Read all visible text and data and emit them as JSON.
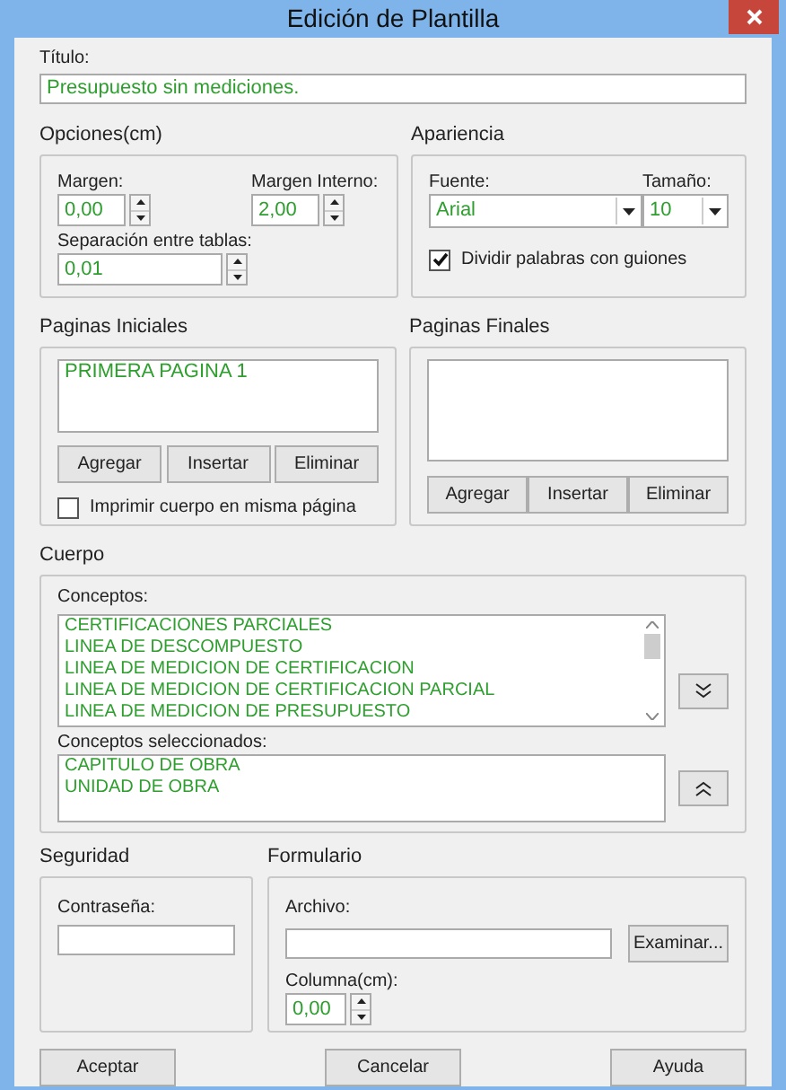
{
  "window": {
    "title": "Edición de Plantilla"
  },
  "titulo": {
    "label": "Título:",
    "value": "Presupuesto sin mediciones."
  },
  "opciones": {
    "header": "Opciones(cm)",
    "margen": {
      "label": "Margen:",
      "value": "0,00"
    },
    "margen_interno": {
      "label": "Margen Interno:",
      "value": "2,00"
    },
    "separacion": {
      "label": "Separación entre tablas:",
      "value": "0,01"
    }
  },
  "apariencia": {
    "header": "Apariencia",
    "fuente": {
      "label": "Fuente:",
      "value": "Arial"
    },
    "tamano": {
      "label": "Tamaño:",
      "value": "10"
    },
    "dividir": {
      "label": "Dividir palabras con guiones",
      "checked": true
    }
  },
  "paginas_iniciales": {
    "header": "Paginas Iniciales",
    "items": [
      "PRIMERA PAGINA 1"
    ],
    "buttons": [
      "Agregar",
      "Insertar",
      "Eliminar"
    ],
    "imprimir": {
      "label": "Imprimir cuerpo en misma página",
      "checked": false
    }
  },
  "paginas_finales": {
    "header": "Paginas Finales",
    "buttons": [
      "Agregar",
      "Insertar",
      "Eliminar"
    ]
  },
  "cuerpo": {
    "header": "Cuerpo",
    "conceptos_label": "Conceptos:",
    "conceptos": [
      "CERTIFICACIONES PARCIALES",
      "LINEA DE DESCOMPUESTO",
      "LINEA DE MEDICION DE CERTIFICACION",
      "LINEA DE MEDICION DE CERTIFICACION PARCIAL",
      "LINEA DE MEDICION DE PRESUPUESTO"
    ],
    "seleccionados_label": "Conceptos seleccionados:",
    "seleccionados": [
      "CAPITULO DE OBRA",
      "UNIDAD DE OBRA"
    ]
  },
  "seguridad": {
    "header": "Seguridad",
    "label": "Contraseña:"
  },
  "formulario": {
    "header": "Formulario",
    "archivo_label": "Archivo:",
    "examinar": "Examinar...",
    "columna": {
      "label": "Columna(cm):",
      "value": "0,00"
    }
  },
  "buttons": [
    "Aceptar",
    "Cancelar",
    "Ayuda"
  ]
}
